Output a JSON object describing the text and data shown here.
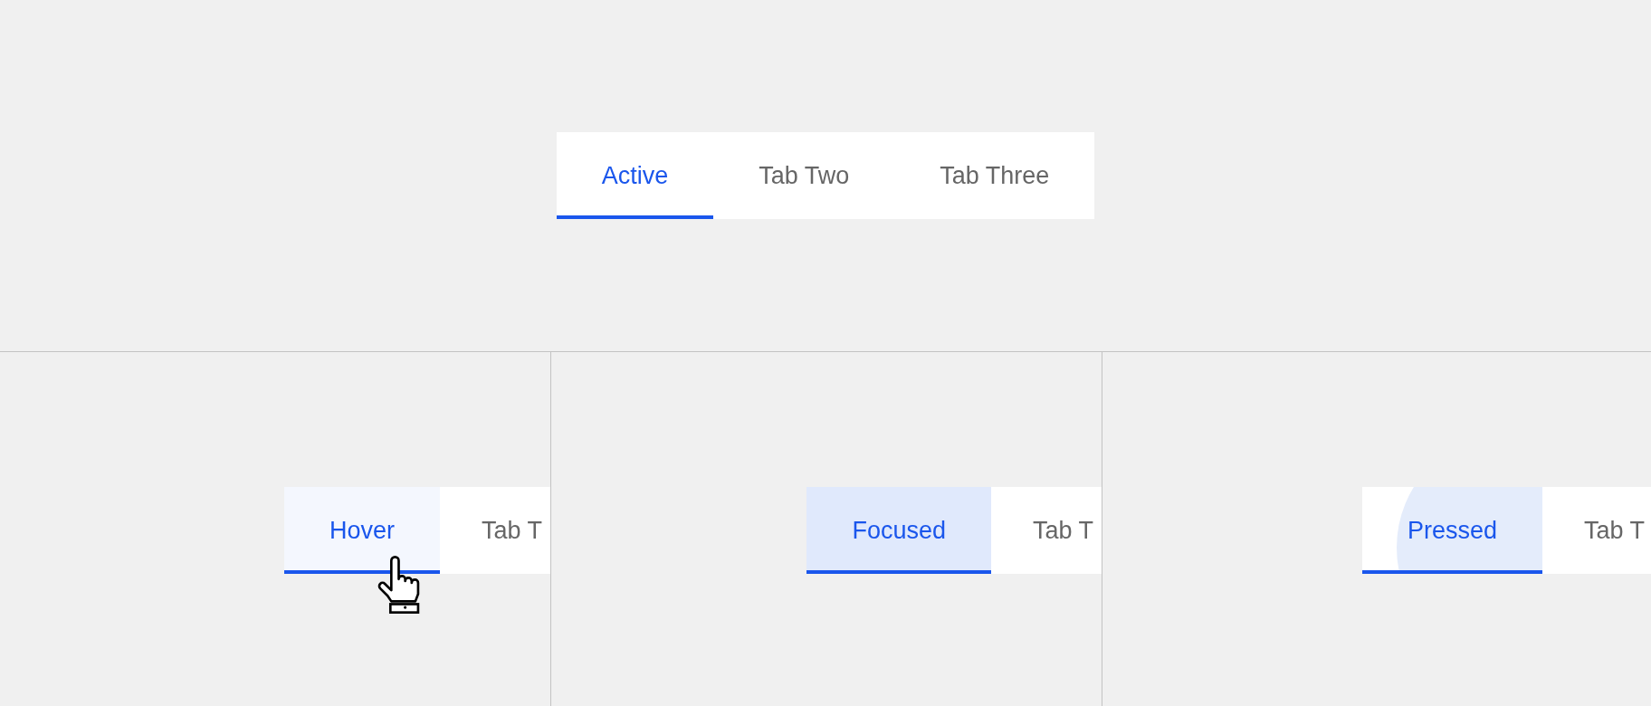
{
  "main_tabs": [
    {
      "label": "Active",
      "selected": true
    },
    {
      "label": "Tab Two",
      "selected": false
    },
    {
      "label": "Tab Three",
      "selected": false
    }
  ],
  "state_panels": [
    {
      "kind": "hover",
      "tabs": [
        {
          "label": "Hover",
          "selected": true
        },
        {
          "label": "Tab T",
          "selected": false
        }
      ]
    },
    {
      "kind": "focused",
      "tabs": [
        {
          "label": "Focused",
          "selected": true
        },
        {
          "label": "Tab T",
          "selected": false
        }
      ]
    },
    {
      "kind": "pressed",
      "tabs": [
        {
          "label": "Pressed",
          "selected": true
        },
        {
          "label": "Tab T",
          "selected": false
        }
      ]
    }
  ]
}
